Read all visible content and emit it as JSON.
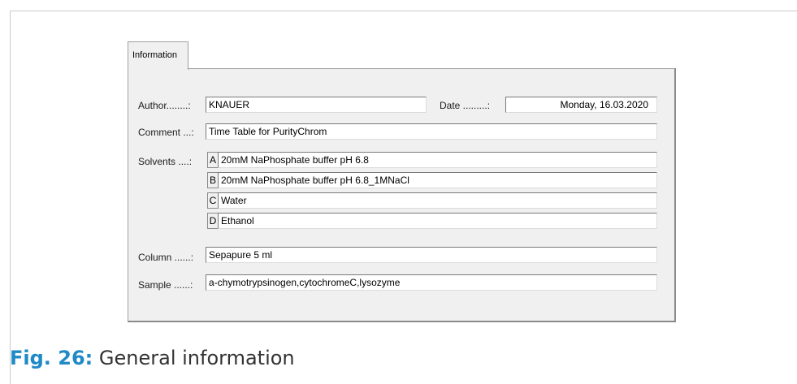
{
  "tab": {
    "label": "Information"
  },
  "author": {
    "label": "Author........:",
    "value": "KNAUER"
  },
  "date": {
    "label": "Date .........:",
    "value": "Monday, 16.03.2020"
  },
  "comment": {
    "label": "Comment ...:",
    "value": "Time Table for  PurityChrom"
  },
  "solvents": {
    "label": "Solvents ....:",
    "items": [
      {
        "letter": "A",
        "value": "20mM NaPhosphate buffer pH 6.8"
      },
      {
        "letter": "B",
        "value": "20mM NaPhosphate buffer pH 6.8_1MNaCl"
      },
      {
        "letter": "C",
        "value": "Water"
      },
      {
        "letter": "D",
        "value": "Ethanol"
      }
    ]
  },
  "column": {
    "label": "Column ......:",
    "value": "Sepapure 5 ml"
  },
  "sample": {
    "label": "Sample ......:",
    "value": "a-chymotrypsinogen,cytochromeC,lysozyme"
  },
  "caption": {
    "number": "Fig. 26:",
    "text": " General information"
  }
}
